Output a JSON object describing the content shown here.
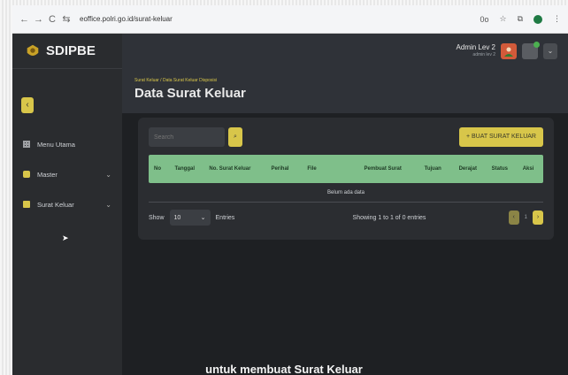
{
  "browser": {
    "url": "eoffice.polri.go.id/surat-keluar",
    "extension_label": "0o",
    "nav_back": "←",
    "nav_forward": "→",
    "nav_reload": "C"
  },
  "sidebar": {
    "brand": "SDIPBE",
    "collapse_glyph": "‹",
    "items": [
      {
        "label": "Menu Utama",
        "has_chevron": false
      },
      {
        "label": "Master",
        "has_chevron": true
      },
      {
        "label": "Surat Keluar",
        "has_chevron": true
      }
    ]
  },
  "topbar": {
    "user_name": "Admin Lev 2",
    "user_sub": "admin lev 2",
    "dropdown_glyph": "⌄"
  },
  "page": {
    "breadcrumb": "Surat Keluar / Data Surat Keluar Disposisi",
    "title": "Data Surat Keluar"
  },
  "toolbar": {
    "search_placeholder": "Search",
    "add_button": "+ BUAT SURAT KELUAR"
  },
  "table": {
    "columns": [
      "No",
      "Tanggal",
      "No. Surat Keluar",
      "Perihal",
      "File",
      "Pembuat Surat",
      "Tujuan",
      "Derajat",
      "Status",
      "Aksi"
    ],
    "empty_text": "Belum ada data"
  },
  "footer": {
    "show_label": "Show",
    "entries_value": "10",
    "entries_label": "Entries",
    "info": "Showing 1 to 1 of 0 entries",
    "page_number": "1",
    "prev_glyph": "‹",
    "next_glyph": "›"
  },
  "caption": "untuk membuat Surat Keluar",
  "colors": {
    "accent": "#d8c64a",
    "table_header": "#7fbf8a",
    "sidebar_bg": "#2a2c2f",
    "content_bg": "#1e2023"
  }
}
